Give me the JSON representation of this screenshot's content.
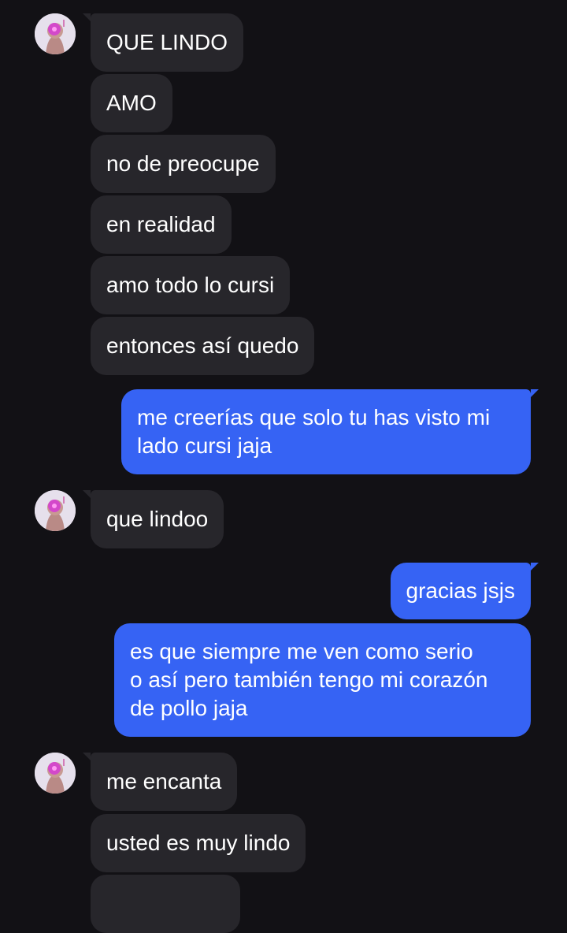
{
  "conversation": {
    "contact_avatar_icon": "contact-avatar-photo",
    "colors": {
      "background": "#121115",
      "incoming_bubble": "#27262b",
      "outgoing_bubble": "#3663f4",
      "text": "#ffffff"
    },
    "messages": [
      {
        "direction": "in",
        "lines": [
          "QUE LINDO"
        ]
      },
      {
        "direction": "in",
        "lines": [
          "AMO"
        ]
      },
      {
        "direction": "in",
        "lines": [
          "no de preocupe"
        ]
      },
      {
        "direction": "in",
        "lines": [
          "en realidad"
        ]
      },
      {
        "direction": "in",
        "lines": [
          "amo todo lo cursi"
        ]
      },
      {
        "direction": "in",
        "lines": [
          "entonces así quedo"
        ]
      },
      {
        "direction": "out",
        "lines": [
          "me creerías que solo tu has visto mi",
          "lado cursi jaja"
        ]
      },
      {
        "direction": "in",
        "lines": [
          "que lindoo"
        ]
      },
      {
        "direction": "out",
        "lines": [
          "gracias jsjs"
        ]
      },
      {
        "direction": "out",
        "lines": [
          "es que siempre me ven como serio",
          "o así pero también tengo mi corazón",
          "de pollo jaja"
        ]
      },
      {
        "direction": "in",
        "lines": [
          "me encanta"
        ]
      },
      {
        "direction": "in",
        "lines": [
          "usted es muy lindo"
        ]
      }
    ]
  }
}
